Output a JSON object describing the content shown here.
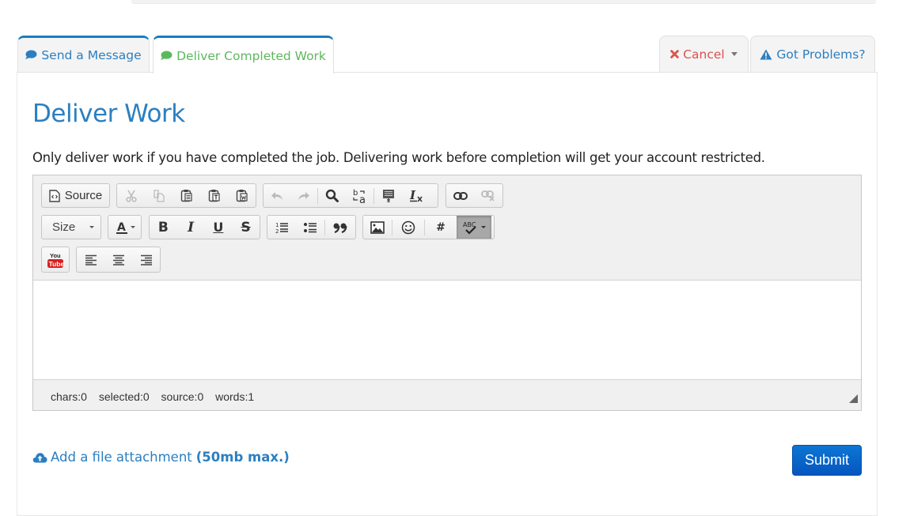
{
  "tabs": {
    "send_message": {
      "label": "Send a Message",
      "icon": "comment-icon"
    },
    "deliver_work": {
      "label": "Deliver Completed Work",
      "icon": "comment-icon",
      "active": true
    },
    "cancel": {
      "label": "Cancel",
      "icon": "times-icon"
    },
    "problems": {
      "label": "Got Problems?",
      "icon": "warning-icon"
    }
  },
  "page": {
    "title": "Deliver Work",
    "warning": "Only deliver work if you have completed the job. Delivering work before completion will get your account restricted."
  },
  "editor": {
    "toolbar": {
      "source_label": "Source",
      "size_label": "Size",
      "buttons": [
        "cut",
        "copy",
        "paste",
        "paste-as-text",
        "paste-from-word",
        "undo",
        "redo",
        "find",
        "replace",
        "select-all",
        "remove-format",
        "link",
        "unlink",
        "text-color",
        "bold",
        "italic",
        "underline",
        "strikethrough",
        "numbered-list",
        "bulleted-list",
        "blockquote",
        "image",
        "smiley",
        "special-char",
        "spell-check",
        "youtube",
        "align-left",
        "align-center",
        "align-right"
      ]
    },
    "content": "",
    "status": {
      "chars": "chars:0",
      "selected": "selected:0",
      "source": "source:0",
      "words": "words:1"
    }
  },
  "attachment": {
    "label": "Add a file attachment",
    "limit": "(50mb max.)"
  },
  "submit_label": "Submit",
  "colors": {
    "primary": "#2b7fc0",
    "success": "#5cb85c",
    "danger": "#d9534f",
    "submit": "#0d6fd0"
  }
}
